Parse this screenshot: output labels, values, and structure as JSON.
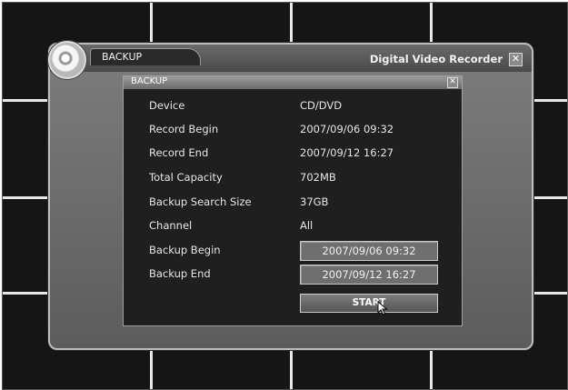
{
  "window": {
    "tab_label": "BACKUP",
    "app_title": "Digital Video Recorder",
    "close_glyph": "✕"
  },
  "panel": {
    "title": "BACKUP",
    "close_glyph": "✕",
    "rows": {
      "device": {
        "label": "Device",
        "value": "CD/DVD"
      },
      "record_begin": {
        "label": "Record Begin",
        "value": "2007/09/06 09:32"
      },
      "record_end": {
        "label": "Record End",
        "value": "2007/09/12 16:27"
      },
      "total_capacity": {
        "label": "Total Capacity",
        "value": "702MB"
      },
      "backup_search_size": {
        "label": "Backup Search Size",
        "value": "37GB"
      },
      "channel": {
        "label": "Channel",
        "value": "All"
      },
      "backup_begin": {
        "label": "Backup Begin",
        "value": "2007/09/06 09:32"
      },
      "backup_end": {
        "label": "Backup End",
        "value": "2007/09/12 16:27"
      }
    },
    "start_label": "START"
  },
  "icons": {
    "disc": "disc-icon",
    "close": "close-icon",
    "cursor": "mouse-cursor-icon"
  }
}
